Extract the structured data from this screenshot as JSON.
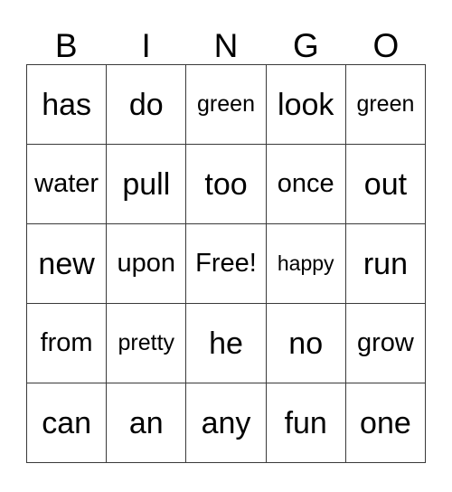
{
  "card": {
    "header": {
      "letters": [
        "B",
        "I",
        "N",
        "G",
        "O"
      ]
    },
    "grid": {
      "columns": 5,
      "rows": 5,
      "free_space_label": "Free!",
      "free_space_position": {
        "row": 3,
        "column": 3
      },
      "cells": [
        [
          {
            "text": "has",
            "size": "lg"
          },
          {
            "text": "do",
            "size": "lg"
          },
          {
            "text": "green",
            "size": "sm"
          },
          {
            "text": "look",
            "size": "lg"
          },
          {
            "text": "green",
            "size": "sm"
          }
        ],
        [
          {
            "text": "water",
            "size": "md"
          },
          {
            "text": "pull",
            "size": "lg"
          },
          {
            "text": "too",
            "size": "lg"
          },
          {
            "text": "once",
            "size": "md"
          },
          {
            "text": "out",
            "size": "lg"
          }
        ],
        [
          {
            "text": "new",
            "size": "lg"
          },
          {
            "text": "upon",
            "size": "md"
          },
          {
            "text": "Free!",
            "size": "md"
          },
          {
            "text": "happy",
            "size": "xs"
          },
          {
            "text": "run",
            "size": "lg"
          }
        ],
        [
          {
            "text": "from",
            "size": "md"
          },
          {
            "text": "pretty",
            "size": "sm"
          },
          {
            "text": "he",
            "size": "lg"
          },
          {
            "text": "no",
            "size": "lg"
          },
          {
            "text": "grow",
            "size": "md"
          }
        ],
        [
          {
            "text": "can",
            "size": "lg"
          },
          {
            "text": "an",
            "size": "lg"
          },
          {
            "text": "any",
            "size": "lg"
          },
          {
            "text": "fun",
            "size": "lg"
          },
          {
            "text": "one",
            "size": "lg"
          }
        ]
      ]
    },
    "colors": {
      "background": "#ffffff",
      "text": "#000000",
      "grid_line": "#3a3a3a"
    }
  }
}
